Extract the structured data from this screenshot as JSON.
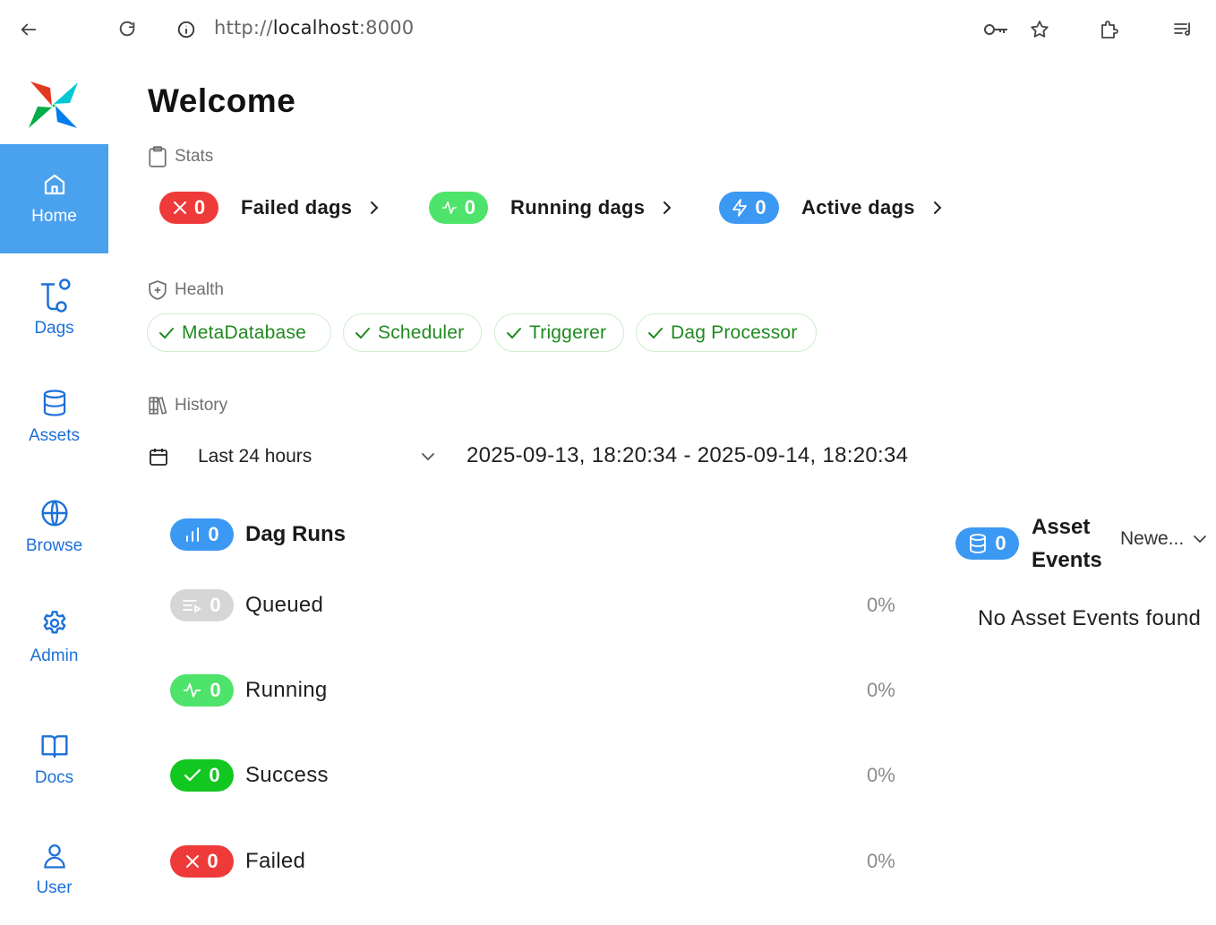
{
  "browser": {
    "url_scheme": "http://",
    "url_host": "localhost",
    "url_port": ":8000"
  },
  "sidebar": {
    "items": [
      {
        "label": "Home",
        "icon": "home-icon",
        "active": true
      },
      {
        "label": "Dags",
        "icon": "dags-icon"
      },
      {
        "label": "Assets",
        "icon": "database-icon"
      },
      {
        "label": "Browse",
        "icon": "globe-icon"
      },
      {
        "label": "Admin",
        "icon": "gear-icon"
      },
      {
        "label": "Docs",
        "icon": "book-icon"
      },
      {
        "label": "User",
        "icon": "user-icon"
      }
    ]
  },
  "page": {
    "title": "Welcome"
  },
  "stats": {
    "label": "Stats",
    "failed": {
      "count": "0",
      "label": "Failed dags",
      "color": "#ef3a3a"
    },
    "running": {
      "count": "0",
      "label": "Running dags",
      "color": "#4ee36a"
    },
    "active": {
      "count": "0",
      "label": "Active dags",
      "color": "#3b98f3"
    }
  },
  "health": {
    "label": "Health",
    "items": [
      "MetaDatabase",
      "Scheduler",
      "Triggerer",
      "Dag Processor"
    ],
    "color": "#1f8a1f"
  },
  "history": {
    "label": "History",
    "timerange": "Last 24 hours",
    "range_text": "2025-09-13, 18:20:34 - 2025-09-14, 18:20:34"
  },
  "dag_runs": {
    "count": "0",
    "title": "Dag Runs",
    "rows": [
      {
        "state": "Queued",
        "count": "0",
        "pct": "0%",
        "color": "#d6d6d6"
      },
      {
        "state": "Running",
        "count": "0",
        "pct": "0%",
        "color": "#4ee36a"
      },
      {
        "state": "Success",
        "count": "0",
        "pct": "0%",
        "color": "#12c71f"
      },
      {
        "state": "Failed",
        "count": "0",
        "pct": "0%",
        "color": "#ef3a3a"
      }
    ]
  },
  "asset_events": {
    "count": "0",
    "title": "Asset Events",
    "sort": "Newe...",
    "empty": "No Asset Events found"
  }
}
